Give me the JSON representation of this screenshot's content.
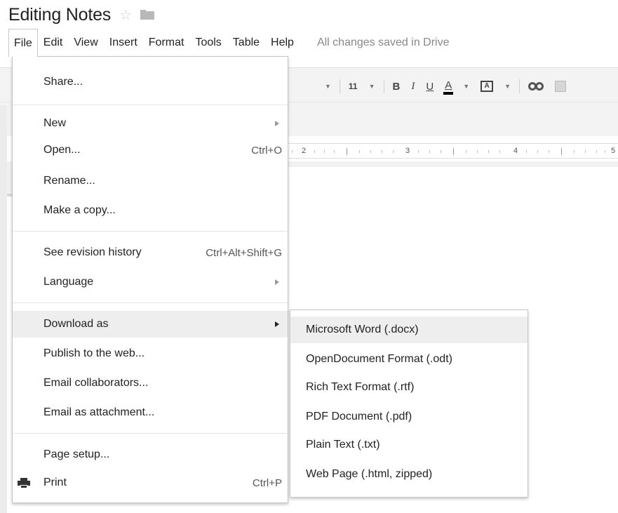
{
  "header": {
    "doc_title": "Editing Notes",
    "star_icon": "star-outline-icon",
    "folder_icon": "folder-icon"
  },
  "menubar": {
    "items": [
      "File",
      "Edit",
      "View",
      "Insert",
      "Format",
      "Tools",
      "Table",
      "Help"
    ],
    "open_menu": "File",
    "save_status": "All changes saved in Drive"
  },
  "toolbar": {
    "font_size": "11",
    "bold": "B",
    "italic": "I",
    "underline": "U",
    "text_color": "A",
    "highlight": "A"
  },
  "ruler": {
    "numbers": [
      "2",
      "3",
      "4",
      "5"
    ]
  },
  "file_menu": {
    "items": [
      {
        "label": "Share...",
        "shortcut": "",
        "submenu": false
      },
      {
        "label": "New",
        "shortcut": "",
        "submenu": true
      },
      {
        "label": "Open...",
        "shortcut": "Ctrl+O",
        "submenu": false
      },
      {
        "label": "Rename...",
        "shortcut": "",
        "submenu": false
      },
      {
        "label": "Make a copy...",
        "shortcut": "",
        "submenu": false
      },
      {
        "label": "See revision history",
        "shortcut": "Ctrl+Alt+Shift+G",
        "submenu": false
      },
      {
        "label": "Language",
        "shortcut": "",
        "submenu": true
      },
      {
        "label": "Download as",
        "shortcut": "",
        "submenu": true,
        "highlighted": true
      },
      {
        "label": "Publish to the web...",
        "shortcut": "",
        "submenu": false
      },
      {
        "label": "Email collaborators...",
        "shortcut": "",
        "submenu": false
      },
      {
        "label": "Email as attachment...",
        "shortcut": "",
        "submenu": false
      },
      {
        "label": "Page setup...",
        "shortcut": "",
        "submenu": false
      },
      {
        "label": "Print",
        "shortcut": "Ctrl+P",
        "submenu": false,
        "icon": "printer-icon"
      }
    ]
  },
  "download_submenu": {
    "items": [
      {
        "label": "Microsoft Word (.docx)",
        "highlighted": true
      },
      {
        "label": "OpenDocument Format (.odt)"
      },
      {
        "label": "Rich Text Format (.rtf)"
      },
      {
        "label": "PDF Document (.pdf)"
      },
      {
        "label": "Plain Text (.txt)"
      },
      {
        "label": "Web Page (.html, zipped)"
      }
    ]
  },
  "colors": {
    "menu_highlight": "#eeeeee",
    "toolbar_bg": "#f3f3f3",
    "status_text": "#888888"
  }
}
